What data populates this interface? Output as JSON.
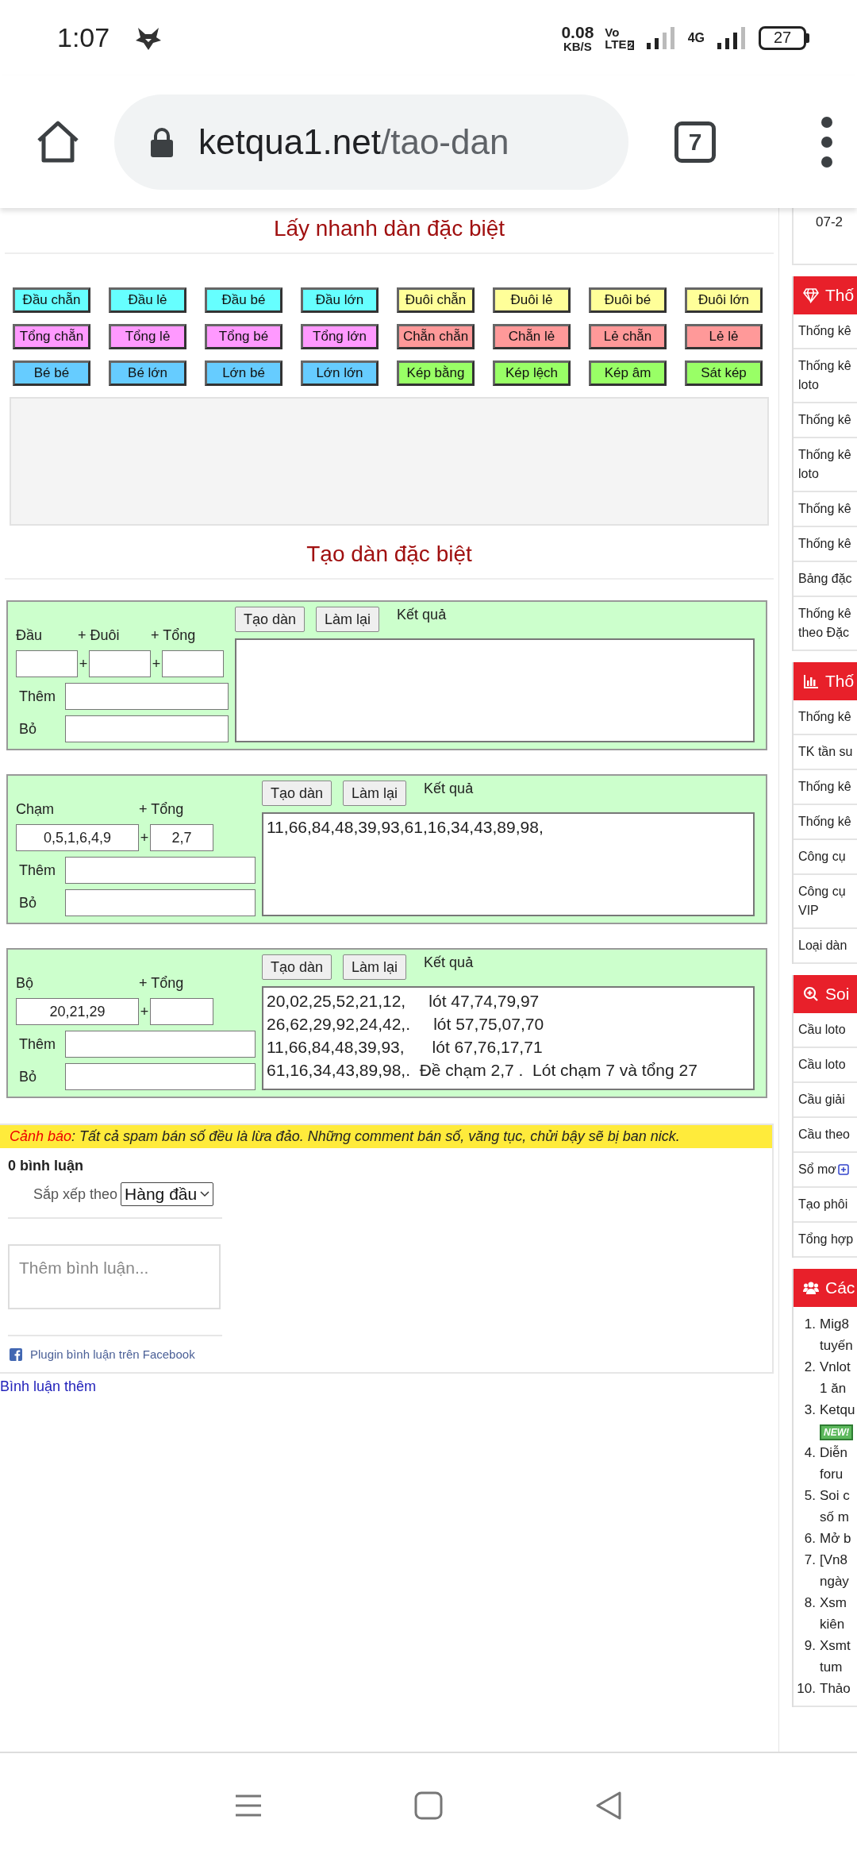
{
  "status_bar": {
    "time": "1:07",
    "speed": "0.08",
    "speed_unit": "KB/S",
    "volte": "Vo",
    "volte_lte": "LTE",
    "sim": "2",
    "network": "4G",
    "battery": "27"
  },
  "browser": {
    "url_host": "ketqua1.net",
    "url_path": "/tao-dan",
    "tab_count": "7"
  },
  "quick_section": {
    "title": "Lấy nhanh dàn đặc biệt",
    "buttons": [
      {
        "label": "Đầu chẵn",
        "color": "#66ffff"
      },
      {
        "label": "Đầu lẻ",
        "color": "#66ffff"
      },
      {
        "label": "Đầu bé",
        "color": "#66ffff"
      },
      {
        "label": "Đầu lớn",
        "color": "#66ffff"
      },
      {
        "label": "Đuôi chẵn",
        "color": "#ffff99"
      },
      {
        "label": "Đuôi lẻ",
        "color": "#ffff99"
      },
      {
        "label": "Đuôi bé",
        "color": "#ffff99"
      },
      {
        "label": "Đuôi lớn",
        "color": "#ffff99"
      },
      {
        "label": "Tổng chẵn",
        "color": "#ff99ff"
      },
      {
        "label": "Tổng lẻ",
        "color": "#ff99ff"
      },
      {
        "label": "Tổng bé",
        "color": "#ff99ff"
      },
      {
        "label": "Tổng lớn",
        "color": "#ff99ff"
      },
      {
        "label": "Chẵn chẵn",
        "color": "#ff9999"
      },
      {
        "label": "Chẵn lẻ",
        "color": "#ff9999"
      },
      {
        "label": "Lẻ chẵn",
        "color": "#ff9999"
      },
      {
        "label": "Lẻ lẻ",
        "color": "#ff9999"
      },
      {
        "label": "Bé bé",
        "color": "#66ccff"
      },
      {
        "label": "Bé lớn",
        "color": "#66ccff"
      },
      {
        "label": "Lớn bé",
        "color": "#66ccff"
      },
      {
        "label": "Lớn lớn",
        "color": "#66ccff"
      },
      {
        "label": "Kép bằng",
        "color": "#99ff66"
      },
      {
        "label": "Kép lệch",
        "color": "#99ff66"
      },
      {
        "label": "Kép âm",
        "color": "#99ff66"
      },
      {
        "label": "Sát kép",
        "color": "#99ff66"
      }
    ]
  },
  "create_section": {
    "title": "Tạo dàn đặc biệt",
    "forms": [
      {
        "kind": "triple",
        "headers": [
          "Đầu",
          "+ Đuôi",
          "+ Tổng"
        ],
        "joiners": [
          "+",
          "+"
        ],
        "add_label": "Thêm",
        "remove_label": "Bỏ",
        "buttons": [
          "Tạo dàn",
          "Làm lại"
        ],
        "result_label": "Kết quả"
      },
      {
        "kind": "pair",
        "headers": [
          "Chạm",
          "+ Tổng"
        ],
        "joiners": [
          "+"
        ],
        "values": [
          "0,5,1,6,4,9",
          "2,7"
        ],
        "add_label": "Thêm",
        "remove_label": "Bỏ",
        "buttons": [
          "Tạo dàn",
          "Làm lại"
        ],
        "result_label": "Kết quả",
        "result": "11,66,84,48,39,93,61,16,34,43,89,98,"
      },
      {
        "kind": "pair",
        "headers": [
          "Bộ",
          "+ Tổng"
        ],
        "joiners": [
          "+"
        ],
        "values": [
          "20,21,29"
        ],
        "add_label": "Thêm",
        "remove_label": "Bỏ",
        "buttons": [
          "Tạo dàn",
          "Làm lại"
        ],
        "result_label": "Kết quả",
        "result": "20,02,25,52,21,12,     lót 47,74,79,97\n26,62,29,92,24,42,.     lót 57,75,07,70\n11,66,84,48,39,93,      lót 67,76,17,71\n61,16,34,43,89,98,.  Đề chạm 2,7 .  Lót chạm 7 và tổng 27"
      }
    ]
  },
  "comments": {
    "warning_label": "Cảnh báo",
    "warning_text": ": Tất cả spam bán số đều là lừa đảo. Những comment bán số, văng tục, chửi bậy sẽ bị ban nick.",
    "count": "0 bình luận",
    "sort_label": "Sắp xếp theo",
    "sort_value": "Hàng đầu",
    "placeholder": "Thêm bình luận...",
    "plugin": "Plugin bình luận trên Facebook",
    "more_link": "Bình luận thêm"
  },
  "sidebar": {
    "date_box": "07-2",
    "groups": [
      {
        "kind": "links",
        "title": "Thố",
        "items": [
          {
            "text": "Thống kê"
          },
          {
            "text": "Thống kê\nloto"
          },
          {
            "text": "Thống kê"
          },
          {
            "text": "Thống kê\nloto"
          },
          {
            "text": "Thống kê"
          },
          {
            "text": "Thống kê"
          },
          {
            "text": "Bảng đặc"
          },
          {
            "text": "Thống kê\ntheo Đặc"
          }
        ]
      },
      {
        "kind": "links",
        "title": "Thố",
        "items": [
          {
            "text": "Thống kê"
          },
          {
            "text": "TK tần su"
          },
          {
            "text": "Thống kê"
          },
          {
            "text": "Thống kê"
          },
          {
            "text": "Công cụ"
          },
          {
            "text": "Công cụ\nVIP"
          },
          {
            "text": "Loại dàn"
          }
        ]
      },
      {
        "kind": "links",
        "title": "Soi",
        "items": [
          {
            "text": "Cầu loto",
            "kind": "plain"
          },
          {
            "text": "Cầu loto",
            "kind": "plain"
          },
          {
            "text": "Cầu giải",
            "kind": "plain"
          },
          {
            "text": "Cầu theo",
            "kind": "plain"
          },
          {
            "text": "Sổ mơ",
            "kind": "expandable"
          },
          {
            "text": "Tạo phôi",
            "kind": "plain"
          },
          {
            "text": "Tổng hợp",
            "kind": "plain"
          }
        ]
      },
      {
        "kind": "numbered",
        "title": "Các",
        "items": [
          {
            "number": "1.",
            "text": "Mig8\ntuyến"
          },
          {
            "number": "2.",
            "text": "Vnlot\n1 ăn"
          },
          {
            "number": "3.",
            "text": "Ketqu",
            "badge": "NEW!"
          },
          {
            "number": "4.",
            "text": "Diễn\nforu"
          },
          {
            "number": "5.",
            "text": "Soi c\nsố m"
          },
          {
            "number": "6.",
            "text": "Mở b"
          },
          {
            "number": "7.",
            "text": "[Vn8\nngày"
          },
          {
            "number": "8.",
            "text": "Xsm\nkiên"
          },
          {
            "number": "9.",
            "text": "Xsmt\ntum"
          },
          {
            "number": "10.",
            "text": "Thảo"
          }
        ]
      }
    ]
  }
}
